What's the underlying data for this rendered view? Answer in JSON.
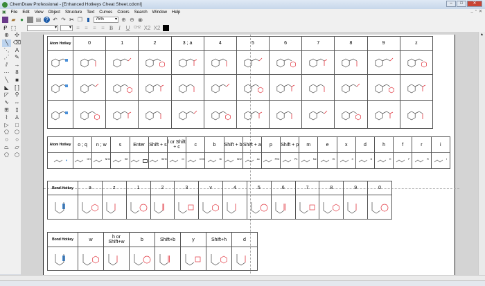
{
  "window": {
    "title": "ChemDraw Professional - [Enhanced Hotkeys Cheat Sheet.cdxml]"
  },
  "menu": [
    "File",
    "Edit",
    "View",
    "Object",
    "Structure",
    "Text",
    "Curves",
    "Colors",
    "Search",
    "Window",
    "Help"
  ],
  "toolbar": {
    "zoom_value": "75%"
  },
  "format": {
    "bold": "B",
    "italic": "I",
    "underline": "U",
    "charge": "CH2",
    "subscript": "X2",
    "superscript": "X2"
  },
  "atom_table": {
    "header": "Atom Hotkey",
    "keys": [
      "0",
      "1",
      "2",
      "3 ; a",
      "4",
      "5",
      "6",
      "7",
      "8",
      "9",
      "z"
    ]
  },
  "atom_table2": {
    "header": "Atom Hotkey",
    "keys": [
      "o ; q",
      "n ; w",
      "s",
      "Enter",
      "Shift + s",
      "l or Shift + c",
      "c",
      "b",
      "Shift + b",
      "Shift + a",
      "p",
      "Shift + p",
      "m",
      "e",
      "x",
      "d",
      "h",
      "f",
      "r",
      "i"
    ],
    "groups": [
      "OH",
      "NH2",
      "SH",
      "",
      "SiH3",
      "Cl",
      "CH3",
      "Br",
      "BH2",
      "Ac",
      "PH2",
      "Ph",
      "Me",
      "Et",
      "X",
      "D",
      "H",
      "F",
      "R",
      "I"
    ]
  },
  "bond_table": {
    "header": "Bond Hotkey",
    "keys": [
      "a",
      "z",
      "1",
      "2",
      "3",
      "v",
      "4",
      "5",
      "6",
      "7",
      "8",
      "9",
      "0"
    ]
  },
  "bond_table2": {
    "header": "Bond Hotkey",
    "keys": [
      "w",
      "h or Shift+w",
      "b",
      "Shift+b",
      "y",
      "Shift+h",
      "d"
    ]
  },
  "colors": {
    "accent": "#e0303a",
    "selection": "#4a90d9"
  }
}
